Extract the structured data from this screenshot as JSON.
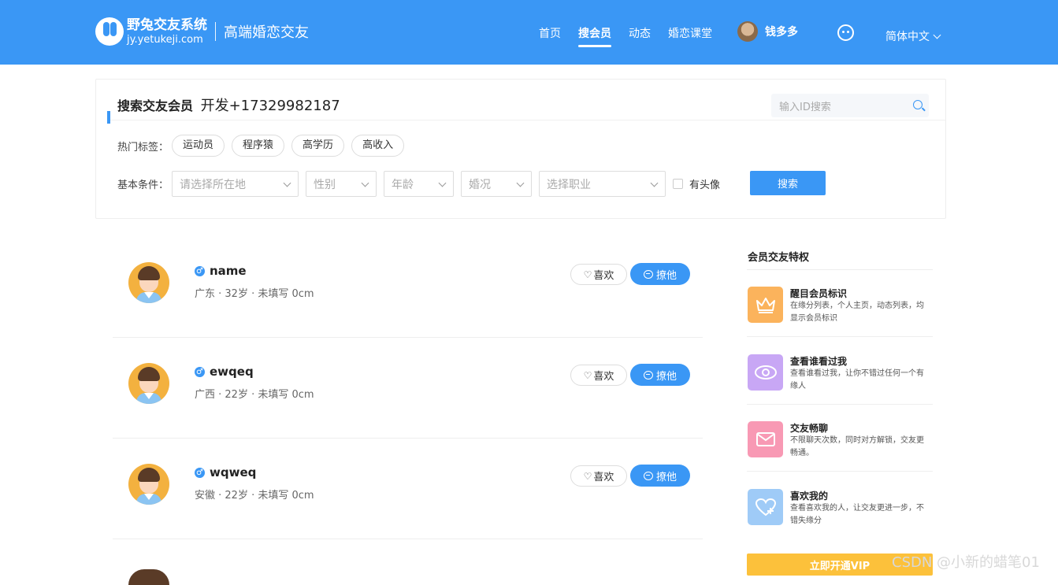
{
  "header": {
    "logo_name": "野兔交友系统",
    "logo_domain": "jy.yetukeji.com",
    "slogan": "高端婚恋交友",
    "nav": [
      {
        "label": "首页",
        "active": false
      },
      {
        "label": "搜会员",
        "active": true
      },
      {
        "label": "动态",
        "active": false
      },
      {
        "label": "婚恋课堂",
        "active": false
      }
    ],
    "user_name": "钱多多",
    "language": "简体中文",
    "brand_color": "#3a97f5"
  },
  "search": {
    "title": "搜索交友会员",
    "dev_note": "开发+17329982187",
    "id_placeholder": "输入ID搜索",
    "hot_tags_label": "热门标签：",
    "hot_tags": [
      "运动员",
      "程序猿",
      "高学历",
      "高收入"
    ],
    "conditions_label": "基本条件：",
    "selects": [
      {
        "placeholder": "请选择所在地"
      },
      {
        "placeholder": "性别"
      },
      {
        "placeholder": "年龄"
      },
      {
        "placeholder": "婚况"
      },
      {
        "placeholder": "选择职业"
      }
    ],
    "has_avatar_label": "有头像",
    "search_button": "搜索"
  },
  "members": [
    {
      "name": "name",
      "info": "广东 · 32岁 · 未填写 0cm",
      "like": "喜欢",
      "chat": "撩他"
    },
    {
      "name": "ewqeq",
      "info": "广西 · 22岁 · 未填写 0cm",
      "like": "喜欢",
      "chat": "撩他"
    },
    {
      "name": "wqweq",
      "info": "安徽 · 22岁 · 未填写 0cm",
      "like": "喜欢",
      "chat": "撩他"
    }
  ],
  "sidebar": {
    "title": "会员交友特权",
    "privileges": [
      {
        "title": "醒目会员标识",
        "desc": "在缘分列表，个人主页，动态列表，均显示会员标识",
        "color": "#fbb35c",
        "icon": "crown-icon"
      },
      {
        "title": "查看谁看过我",
        "desc": "查看谁看过我，让你不错过任何一个有缘人",
        "color": "#c8a7f5",
        "icon": "eye-icon"
      },
      {
        "title": "交友畅聊",
        "desc": "不限聊天次数，同时对方解锁，交友更畅通。",
        "color": "#f899b4",
        "icon": "mail-icon"
      },
      {
        "title": "喜欢我的",
        "desc": "查看喜欢我的人，让交友更进一步，不错失缘分",
        "color": "#9fcbf7",
        "icon": "heart-plus-icon"
      }
    ],
    "vip_button": "立即开通VIP"
  },
  "watermark": "CSDN @小新的蜡笔01"
}
